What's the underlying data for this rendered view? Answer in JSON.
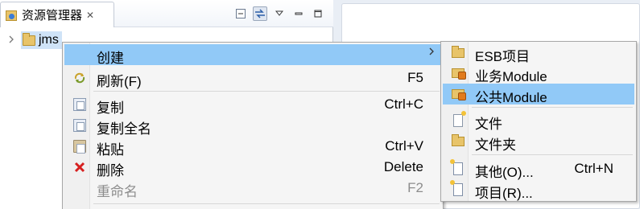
{
  "explorer": {
    "tab_title": "资源管理器",
    "close_glyph": "✕",
    "tree": {
      "root_label": "jms"
    }
  },
  "context_menu": {
    "items": [
      {
        "label": "创建",
        "accel": "",
        "icon": "none",
        "submenu": true,
        "highlighted": true
      },
      {
        "label": "刷新(F)",
        "accel": "F5",
        "icon": "refresh-icon"
      },
      {
        "label": "复制",
        "accel": "Ctrl+C",
        "icon": "copy-icon"
      },
      {
        "label": "复制全名",
        "accel": "",
        "icon": "copy-full-name-icon"
      },
      {
        "label": "粘贴",
        "accel": "Ctrl+V",
        "icon": "paste-icon"
      },
      {
        "label": "删除",
        "accel": "Delete",
        "icon": "delete-icon"
      },
      {
        "label": "重命名",
        "accel": "F2",
        "icon": "none",
        "disabled": true
      }
    ]
  },
  "submenu": {
    "items": [
      {
        "label": "ESB项目",
        "accel": "",
        "icon": "esb-project-icon"
      },
      {
        "label": "业务Module",
        "accel": "",
        "icon": "business-module-icon"
      },
      {
        "label": "公共Module",
        "accel": "",
        "icon": "common-module-icon",
        "highlighted": true
      },
      {
        "label": "文件",
        "accel": "",
        "icon": "file-icon"
      },
      {
        "label": "文件夹",
        "accel": "",
        "icon": "folder-icon"
      },
      {
        "label": "其他(O)...",
        "accel": "Ctrl+N",
        "icon": "other-icon"
      },
      {
        "label": "项目(R)...",
        "accel": "",
        "icon": "project-icon"
      }
    ]
  },
  "colors": {
    "menu_highlight": "#91c9f7",
    "selection": "#cfe3f7",
    "menu_background": "#f5f5f5"
  }
}
